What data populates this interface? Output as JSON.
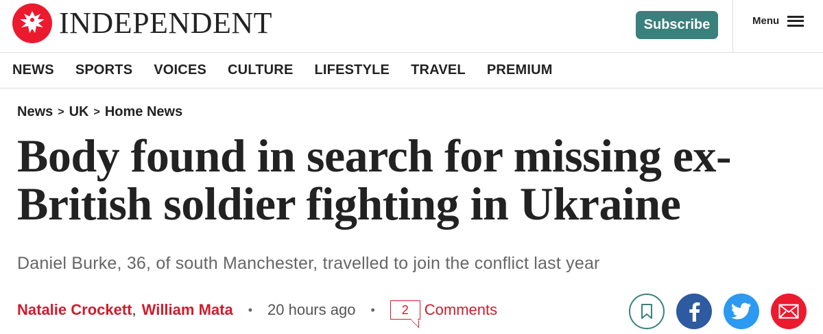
{
  "header": {
    "brand": "INDEPENDENT",
    "subscribe_label": "Subscribe",
    "menu_label": "Menu"
  },
  "nav": {
    "items": [
      "NEWS",
      "SPORTS",
      "VOICES",
      "CULTURE",
      "LIFESTYLE",
      "TRAVEL",
      "PREMIUM"
    ]
  },
  "breadcrumb": {
    "items": [
      "News",
      "UK",
      "Home News"
    ],
    "separator": ">"
  },
  "article": {
    "headline_line1": "Body found in search for missing ex-",
    "headline_line2": "British soldier fighting in Ukraine",
    "standfirst": "Daniel Burke, 36, of south Manchester, travelled to join the conflict last year",
    "authors": [
      "Natalie Crockett",
      "William Mata"
    ],
    "author_separator": ",",
    "published": "20 hours ago",
    "comment_count": "2",
    "comments_label": "Comments"
  },
  "colors": {
    "brand_red": "#ec1a2e",
    "subscribe_green": "#3a807c",
    "facebook": "#2d5aa0",
    "twitter": "#2b9af0",
    "author_red": "#d11b2e"
  },
  "icons": {
    "logo": "eagle-icon",
    "menu": "hamburger-icon",
    "share": [
      "bookmark-icon",
      "facebook-icon",
      "twitter-icon",
      "email-icon"
    ]
  }
}
